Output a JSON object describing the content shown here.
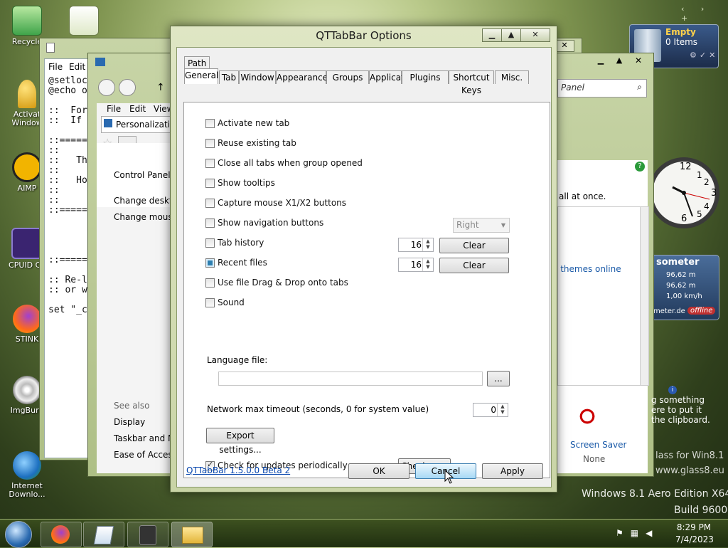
{
  "desktop": {
    "icons": [
      {
        "label": "Recycle"
      },
      {
        "label": "Activat Window"
      },
      {
        "label": "AIMP"
      },
      {
        "label": "CPUID CP"
      },
      {
        "label": "STINK"
      },
      {
        "label": "ImgBurn"
      },
      {
        "label": "Internet Downlo..."
      }
    ],
    "watermark_line1": "Windows 8.1 Aero Edition X64",
    "watermark_line2": "Build 9600",
    "glass_line1": "lass for Win8.1",
    "glass_line2": "www.glass8.eu"
  },
  "recycle_gadget": {
    "title": "Empty",
    "count": "0 Items"
  },
  "speedometer_gadget": {
    "title": "someter",
    "r1": "96,62 m",
    "r2": "96,62 m",
    "r3": "1,00 km/h",
    "site": "meter.de",
    "status": "offline"
  },
  "notepad": {
    "menu": [
      "File",
      "Edit"
    ],
    "lines": [
      "@setloc",
      "@echo o",
      "",
      "::  For",
      "::  If",
      "",
      "::=====",
      "::",
      "::   Th",
      "::",
      "::   Ho",
      "::",
      "::",
      "::=====",
      "",
      "",
      "",
      "",
      "::=====",
      "",
      ":: Re-l",
      ":: or w",
      "",
      "set \"_c"
    ]
  },
  "control_panel": {
    "menu": [
      "File",
      "Edit",
      "View"
    ],
    "address": "Personalizatio",
    "search_text": "Panel",
    "home_link": "Control Panel H",
    "links": [
      "Change deskto",
      "Change mouse"
    ],
    "see_also_heading": "See also",
    "see_also": [
      "Display",
      "Taskbar and Na",
      "Ease of Access"
    ],
    "right_text": "all at once.",
    "themes_online": "e themes online",
    "screen_saver_label": "Screen Saver",
    "screen_saver_value": "None",
    "tip_lines": [
      "g something",
      "ere to put it",
      "the clipboard."
    ]
  },
  "dialog": {
    "title": "QTTabBar Options",
    "tabs_row1": [
      "Path"
    ],
    "tabs_row2": [
      "General",
      "Tab",
      "Window",
      "Appearance",
      "Groups",
      "Applications",
      "Plugins",
      "Shortcut Keys",
      "Misc."
    ],
    "options": [
      {
        "label": "Activate new tab",
        "checked": false
      },
      {
        "label": "Reuse existing tab",
        "checked": false
      },
      {
        "label": "Close all tabs when group opened",
        "checked": false
      },
      {
        "label": "Show tooltips",
        "checked": false
      },
      {
        "label": "Capture mouse X1/X2 buttons",
        "checked": false
      },
      {
        "label": "Show navigation buttons",
        "checked": false
      },
      {
        "label": "Tab history",
        "checked": false
      },
      {
        "label": "Recent files",
        "checked": true
      },
      {
        "label": "Use file Drag & Drop onto tabs",
        "checked": false
      },
      {
        "label": "Sound",
        "checked": false
      }
    ],
    "nav_position": "Right",
    "tab_history_count": "16",
    "recent_files_count": "16",
    "clear_label": "Clear",
    "language_label": "Language file:",
    "language_value": "",
    "browse_label": "...",
    "timeout_label": "Network max timeout (seconds, 0 for system value)",
    "timeout_value": "0",
    "export_label": "Export settings...",
    "updates_label": "Check for updates periodically",
    "check_now_label": "Check now",
    "version_link": "QTTabBar 1.5.0.0 Beta 2",
    "ok_label": "OK",
    "cancel_label": "Cancel",
    "apply_label": "Apply"
  },
  "taskbar": {
    "time": "8:29 PM",
    "date": "7/4/2023"
  }
}
